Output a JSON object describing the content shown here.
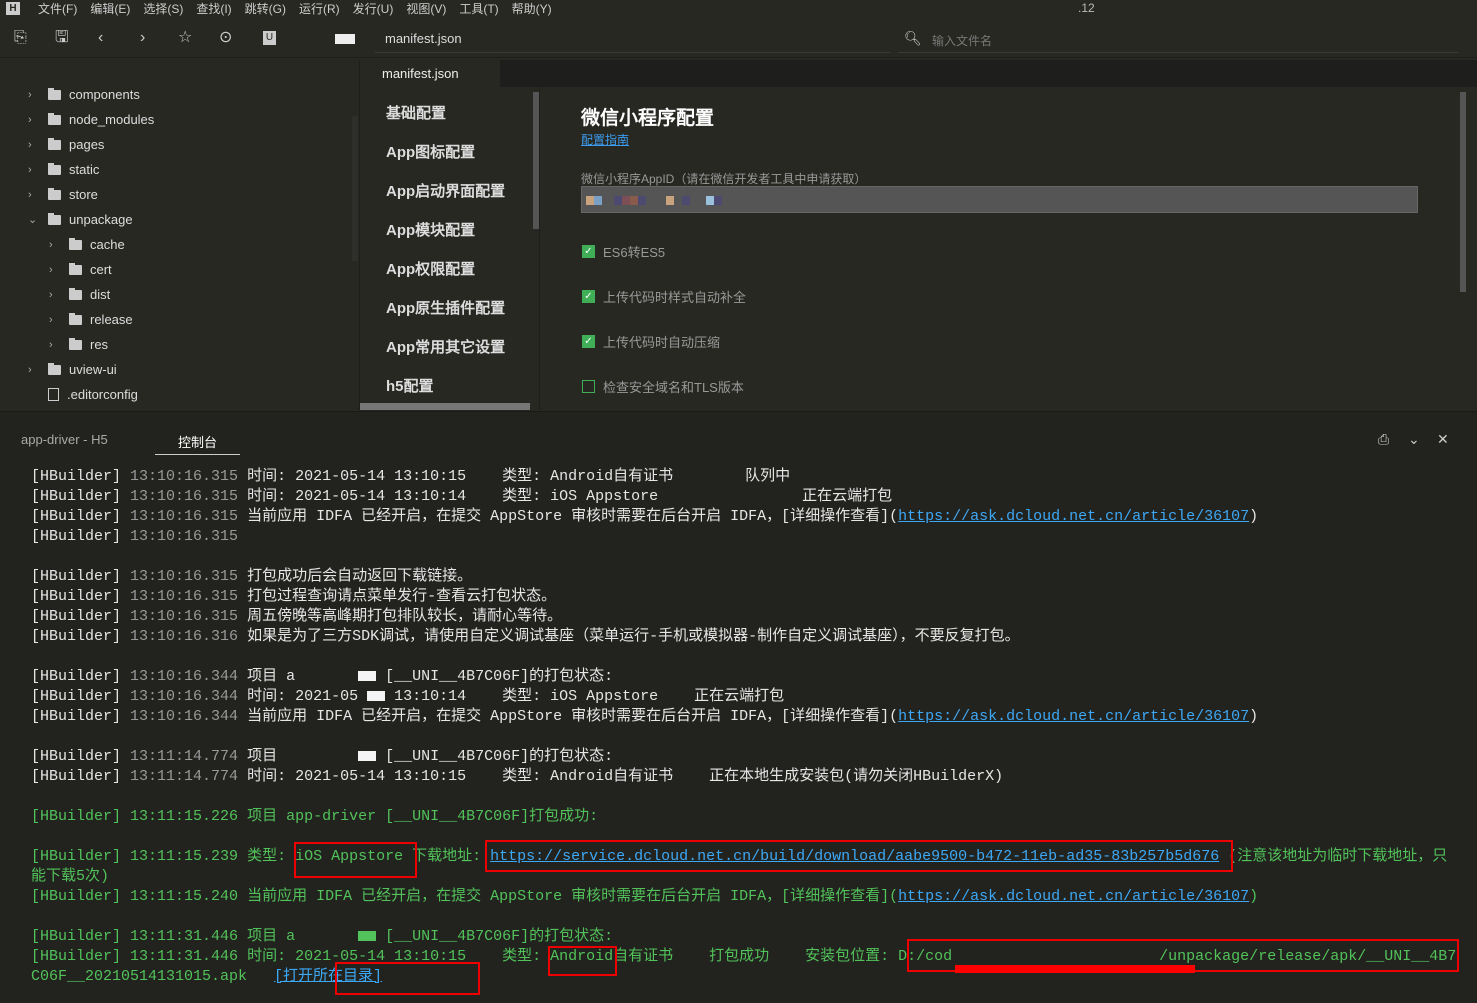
{
  "menu": {
    "items": [
      "文件(F)",
      "编辑(E)",
      "选择(S)",
      "查找(I)",
      "跳转(G)",
      "运行(R)",
      "发行(U)",
      "视图(V)",
      "工具(T)",
      "帮助(Y)"
    ],
    "right": ".12"
  },
  "toolbar": {
    "address": "manifest.json",
    "file_search_placeholder": "输入文件名"
  },
  "tree": [
    {
      "label": "components",
      "level": 0,
      "type": "folder",
      "expanded": false
    },
    {
      "label": "node_modules",
      "level": 0,
      "type": "folder",
      "expanded": false
    },
    {
      "label": "pages",
      "level": 0,
      "type": "folder",
      "expanded": false
    },
    {
      "label": "static",
      "level": 0,
      "type": "folder",
      "expanded": false
    },
    {
      "label": "store",
      "level": 0,
      "type": "folder",
      "expanded": false
    },
    {
      "label": "unpackage",
      "level": 0,
      "type": "folder",
      "expanded": true
    },
    {
      "label": "cache",
      "level": 1,
      "type": "folder",
      "expanded": false
    },
    {
      "label": "cert",
      "level": 1,
      "type": "folder",
      "expanded": false
    },
    {
      "label": "dist",
      "level": 1,
      "type": "folder",
      "expanded": false
    },
    {
      "label": "release",
      "level": 1,
      "type": "folder",
      "expanded": false
    },
    {
      "label": "res",
      "level": 1,
      "type": "folder",
      "expanded": false
    },
    {
      "label": "uview-ui",
      "level": 0,
      "type": "folder",
      "expanded": false
    },
    {
      "label": ".editorconfig",
      "level": 0,
      "type": "file"
    }
  ],
  "editor": {
    "tab": "manifest.json"
  },
  "settings_nav": [
    "基础配置",
    "App图标配置",
    "App启动界面配置",
    "App模块配置",
    "App权限配置",
    "App原生插件配置",
    "App常用其它设置",
    "h5配置"
  ],
  "content": {
    "title": "微信小程序配置",
    "guide_link": "配置指南",
    "appid_label": "微信小程序AppID（请在微信开发者工具中申请获取）",
    "checkboxes": [
      {
        "label": "ES6转ES5",
        "checked": true
      },
      {
        "label": "上传代码时样式自动补全",
        "checked": true
      },
      {
        "label": "上传代码时自动压缩",
        "checked": true
      },
      {
        "label": "检查安全域名和TLS版本",
        "checked": false
      }
    ]
  },
  "console": {
    "tab_project": "app-driver - H5",
    "tab_console": "控制台",
    "colors": {
      "green": "#52c25a",
      "link": "#3da8f5",
      "timestamp": "#999999"
    },
    "lines": [
      {
        "s": [
          [
            "t",
            "[HBuilder] "
          ],
          [
            "ts",
            "13:10:16.315"
          ],
          [
            "t",
            " 时间: 2021-05-14 13:10:15    类型: Android自有证书        队列中"
          ]
        ]
      },
      {
        "s": [
          [
            "t",
            "[HBuilder] "
          ],
          [
            "ts",
            "13:10:16.315"
          ],
          [
            "t",
            " 时间: 2021-05-14 13:10:14    类型: iOS Appstore                正在云端打包"
          ]
        ]
      },
      {
        "s": [
          [
            "t",
            "[HBuilder] "
          ],
          [
            "ts",
            "13:10:16.315"
          ],
          [
            "t",
            " 当前应用 IDFA 已经开启，在提交 AppStore 审核时需要在后台开启 IDFA，[详细操作查看]("
          ],
          [
            "l",
            "https://ask.dcloud.net.cn/article/36107"
          ],
          [
            "t",
            ")"
          ]
        ]
      },
      {
        "s": [
          [
            "t",
            "[HBuilder] "
          ],
          [
            "ts",
            "13:10:16.315"
          ]
        ]
      },
      {
        "s": []
      },
      {
        "s": [
          [
            "t",
            "[HBuilder] "
          ],
          [
            "ts",
            "13:10:16.315"
          ],
          [
            "t",
            " 打包成功后会自动返回下载链接。"
          ]
        ]
      },
      {
        "s": [
          [
            "t",
            "[HBuilder] "
          ],
          [
            "ts",
            "13:10:16.315"
          ],
          [
            "t",
            " 打包过程查询请点菜单发行-查看云打包状态。"
          ]
        ]
      },
      {
        "s": [
          [
            "t",
            "[HBuilder] "
          ],
          [
            "ts",
            "13:10:16.315"
          ],
          [
            "t",
            " 周五傍晚等高峰期打包排队较长，请耐心等待。"
          ]
        ]
      },
      {
        "s": [
          [
            "t",
            "[HBuilder] "
          ],
          [
            "ts",
            "13:10:16.316"
          ],
          [
            "t",
            " 如果是为了三方SDK调试，请使用自定义调试基座（菜单运行-手机或模拟器-制作自定义调试基座），不要反复打包。"
          ]
        ]
      },
      {
        "s": []
      },
      {
        "s": [
          [
            "t",
            "[HBuilder] "
          ],
          [
            "ts",
            "13:10:16.344"
          ],
          [
            "t",
            " 项目 a       "
          ],
          [
            "m",
            ""
          ],
          [
            "t",
            " [__UNI__4B7C06F]的打包状态:"
          ]
        ]
      },
      {
        "s": [
          [
            "t",
            "[HBuilder] "
          ],
          [
            "ts",
            "13:10:16.344"
          ],
          [
            "t",
            " 时间: 2021-05 "
          ],
          [
            "m",
            ""
          ],
          [
            "t",
            " 13:10:14    类型: iOS Appstore    正在云端打包"
          ]
        ]
      },
      {
        "s": [
          [
            "t",
            "[HBuilder] "
          ],
          [
            "ts",
            "13:10:16.344"
          ],
          [
            "t",
            " 当前应用 IDFA 已经开启，在提交 AppStore 审核时需要在后台开启 IDFA，[详细操作查看]("
          ],
          [
            "l",
            "https://ask.dcloud.net.cn/article/36107"
          ],
          [
            "t",
            ")"
          ]
        ]
      },
      {
        "s": []
      },
      {
        "s": [
          [
            "t",
            "[HBuilder] "
          ],
          [
            "ts",
            "13:11:14.774"
          ],
          [
            "t",
            " 项目         "
          ],
          [
            "m",
            ""
          ],
          [
            "t",
            " [__UNI__4B7C06F]的打包状态:"
          ]
        ]
      },
      {
        "s": [
          [
            "t",
            "[HBuilder] "
          ],
          [
            "ts",
            "13:11:14.774"
          ],
          [
            "t",
            " 时间: 2021-05-14 13:10:15    类型: Android自有证书    正在本地生成安装包(请勿关闭HBuilderX)"
          ]
        ]
      },
      {
        "s": []
      },
      {
        "g": true,
        "s": [
          [
            "t",
            "[HBuilder] "
          ],
          [
            "ts",
            "13:11:15.226"
          ],
          [
            "t",
            " 项目 app-driver [__UNI__4B7C06F]打包成功:"
          ]
        ]
      },
      {
        "s": []
      },
      {
        "g": true,
        "s": [
          [
            "t",
            "[HBuilder] "
          ],
          [
            "ts",
            "13:11:15.239"
          ],
          [
            "t",
            " 类型: iOS Appstore 下载地址: "
          ],
          [
            "l",
            "https://service.dcloud.net.cn/build/download/aabe9500-b472-11eb-ad35-83b257b5d676"
          ],
          [
            "t",
            " (注意该地址为临时下载地址，只能下载5次)"
          ]
        ]
      },
      {
        "g": true,
        "s": [
          [
            "t",
            "[HBuilder] "
          ],
          [
            "ts",
            "13:11:15.240"
          ],
          [
            "t",
            " 当前应用 IDFA 已经开启，在提交 AppStore 审核时需要在后台开启 IDFA，[详细操作查看]("
          ],
          [
            "l",
            "https://ask.dcloud.net.cn/article/36107"
          ],
          [
            "t",
            ")"
          ]
        ]
      },
      {
        "s": []
      },
      {
        "g": true,
        "s": [
          [
            "t",
            "[HBuilder] "
          ],
          [
            "ts",
            "13:11:31.446"
          ],
          [
            "t",
            " 项目 a       "
          ],
          [
            "m",
            ""
          ],
          [
            "t",
            " [__UNI__4B7C06F]的打包状态:"
          ]
        ]
      },
      {
        "g": true,
        "s": [
          [
            "t",
            "[HBuilder] "
          ],
          [
            "ts",
            "13:11:31.446"
          ],
          [
            "t",
            " 时间: 2021-05-14 13:10:15    类型: Android自有证书    打包成功    安装包位置: D:/cod                       /unpackage/release/apk/__UNI__4B7C06F__20210514131015.apk   "
          ],
          [
            "l",
            "[打开所在目录]"
          ]
        ]
      }
    ]
  }
}
